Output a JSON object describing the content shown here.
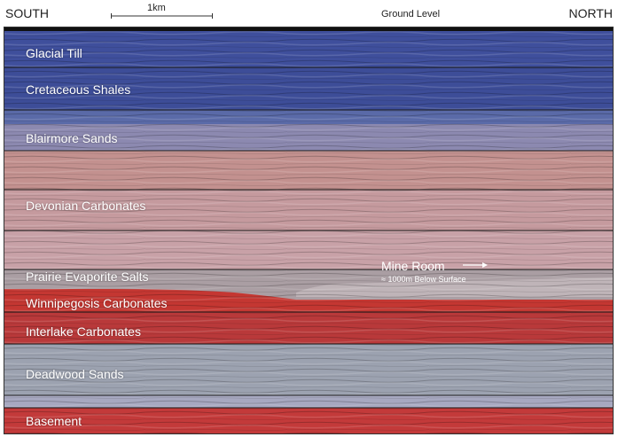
{
  "header": {
    "south": "SOUTH",
    "north": "NORTH",
    "ground_level": "Ground Level",
    "scale": "1km"
  },
  "layers": [
    {
      "label": "Glacial Till",
      "color": "#3f4f9c"
    },
    {
      "label": "Cretaceous Shales",
      "color": "#3d4d98"
    },
    {
      "label": "Blairmore Sands",
      "color": "#8c89b0"
    },
    {
      "label": "Devonian Carbonates",
      "color": "#c59a9e"
    },
    {
      "label": "Prairie Evaporite Salts",
      "color": "#aa9ea3"
    },
    {
      "label": "Winnipegosis Carbonates",
      "color": "#c43732"
    },
    {
      "label": "Interlake Carbonates",
      "color": "#b9393a"
    },
    {
      "label": "Deadwood Sands",
      "color": "#9ca2b0"
    },
    {
      "label": "Basement",
      "color": "#c33a3a"
    }
  ],
  "mine_room": {
    "title": "Mine Room",
    "depth": "≈ 1000m Below Surface"
  }
}
